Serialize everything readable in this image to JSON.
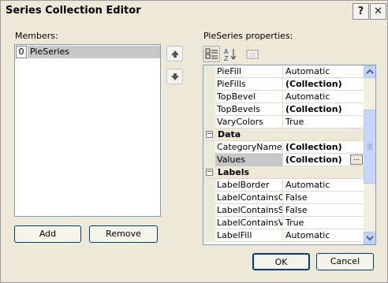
{
  "title": "Series Collection Editor",
  "titlebar": {
    "help": "?",
    "close": "✕"
  },
  "members": {
    "label": "Members:",
    "items": [
      {
        "index": "0",
        "name": "PieSeries"
      }
    ]
  },
  "properties": {
    "label": "PieSeries properties:",
    "rows": [
      {
        "name": "PieFill",
        "value": "Automatic"
      },
      {
        "name": "PieFills",
        "value": "(Collection)"
      },
      {
        "name": "TopBevel",
        "value": "Automatic"
      },
      {
        "name": "TopBevels",
        "value": "(Collection)"
      },
      {
        "name": "VaryColors",
        "value": "True"
      },
      {
        "category": "Data",
        "toggle": "⊟"
      },
      {
        "name": "CategoryNames",
        "value": "(Collection)"
      },
      {
        "name": "Values",
        "value": "(Collection)",
        "ellipsis": "..."
      },
      {
        "category": "Labels",
        "toggle": "⊟"
      },
      {
        "name": "LabelBorder",
        "value": "Automatic"
      },
      {
        "name": "LabelContainsCat",
        "value": "False"
      },
      {
        "name": "LabelContainsSer",
        "value": "False"
      },
      {
        "name": "LabelContainsVal",
        "value": "True"
      },
      {
        "name": "LabelFill",
        "value": "Automatic"
      }
    ]
  },
  "buttons": {
    "add": "Add",
    "remove": "Remove",
    "ok": "OK",
    "cancel": "Cancel"
  },
  "colors": {
    "face": "#ece9d8",
    "selection": "#c7c7c7",
    "border": "#7f9db9"
  }
}
